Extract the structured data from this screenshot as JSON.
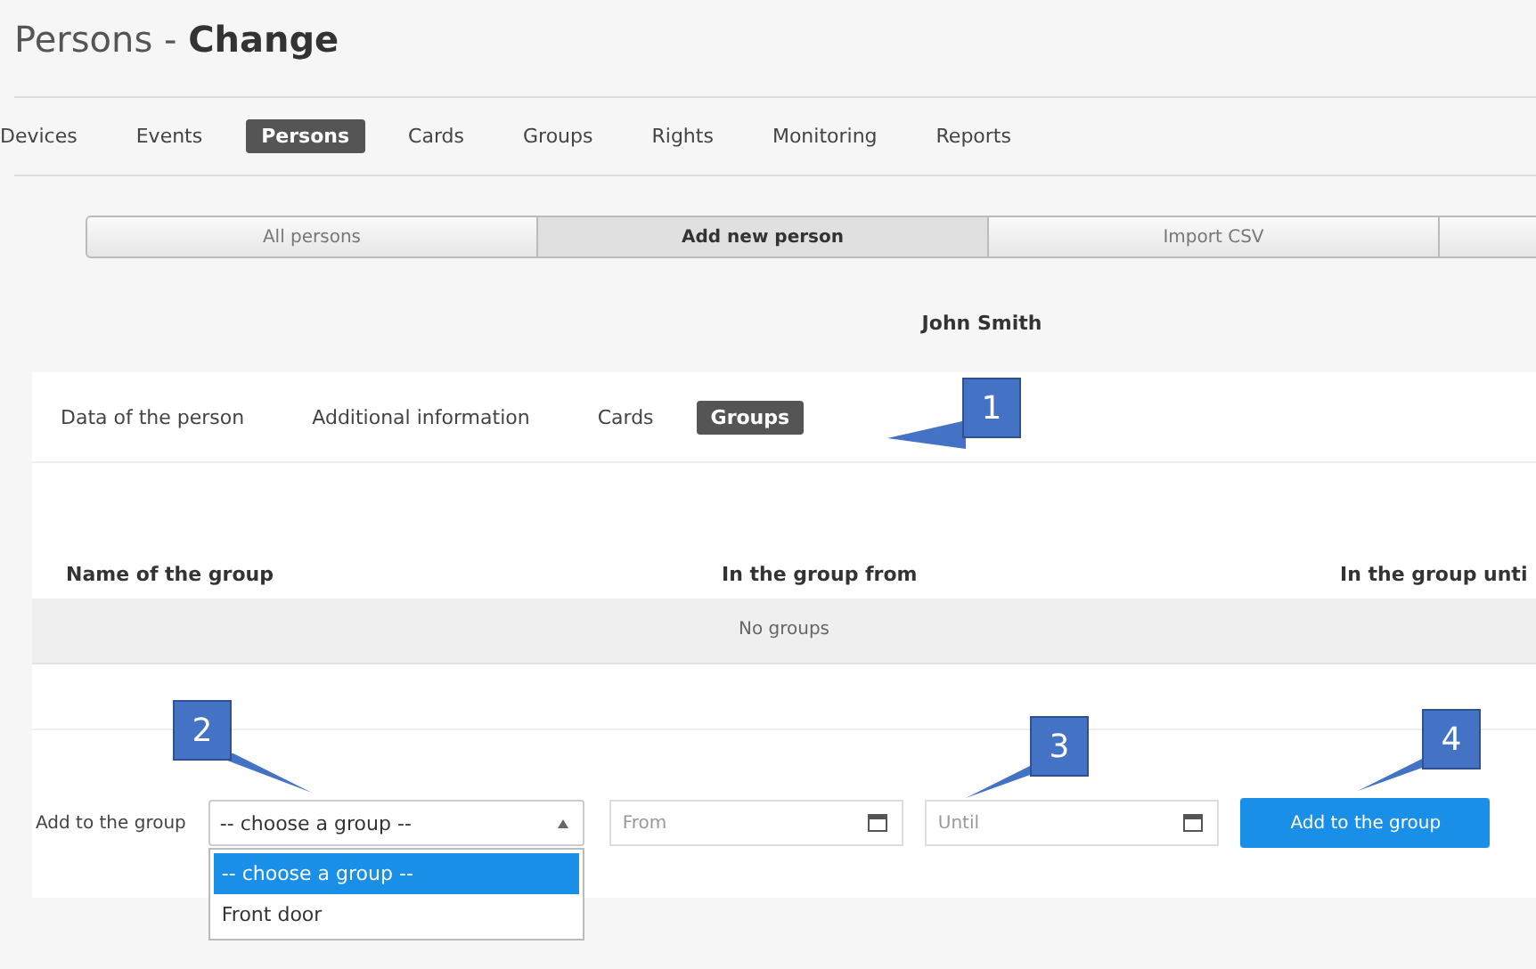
{
  "page_title": {
    "plain": "Persons - ",
    "bold": "Change"
  },
  "main_nav": [
    {
      "label": "Devices",
      "selected": false
    },
    {
      "label": "Events",
      "selected": false
    },
    {
      "label": "Persons",
      "selected": true
    },
    {
      "label": "Cards",
      "selected": false
    },
    {
      "label": "Groups",
      "selected": false
    },
    {
      "label": "Rights",
      "selected": false
    },
    {
      "label": "Monitoring",
      "selected": false
    },
    {
      "label": "Reports",
      "selected": false
    }
  ],
  "segments": [
    {
      "label": "All persons",
      "selected": false
    },
    {
      "label": "Add new person",
      "selected": true
    },
    {
      "label": "Import CSV",
      "selected": false
    }
  ],
  "person_name": "John Smith",
  "person_tabs": [
    {
      "label": "Data of the person",
      "selected": false
    },
    {
      "label": "Additional information",
      "selected": false
    },
    {
      "label": "Cards",
      "selected": false
    },
    {
      "label": "Groups",
      "selected": true
    }
  ],
  "table": {
    "columns": [
      "Name of the group",
      "In the group from",
      "In the group unti"
    ],
    "empty_text": "No groups"
  },
  "add_form": {
    "label": "Add to the group",
    "select": {
      "value": "-- choose a group --",
      "expanded": true,
      "options": [
        {
          "label": "-- choose a group --",
          "selected": true
        },
        {
          "label": "Front door",
          "selected": false
        }
      ]
    },
    "from": {
      "placeholder": "From"
    },
    "until": {
      "placeholder": "Until"
    },
    "button": "Add to the group"
  },
  "callouts": [
    {
      "number": "1",
      "kind": "left"
    },
    {
      "number": "2",
      "kind": "down"
    },
    {
      "number": "3",
      "kind": "downleft"
    },
    {
      "number": "4",
      "kind": "downleft"
    }
  ]
}
